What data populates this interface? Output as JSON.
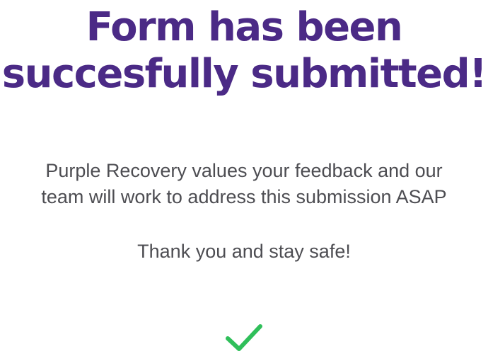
{
  "confirmation": {
    "title_line1": "Form has been",
    "title_line2": "succesfully submitted!",
    "message_line1": "Purple Recovery values your feedback and our",
    "message_line2": "team will work to address this submission ASAP",
    "thanks": "Thank you and stay safe!",
    "icon": "checkmark-icon"
  },
  "colors": {
    "title": "#4b2a86",
    "text": "#4d4d52",
    "check": "#2fbf5a",
    "background": "#ffffff"
  }
}
